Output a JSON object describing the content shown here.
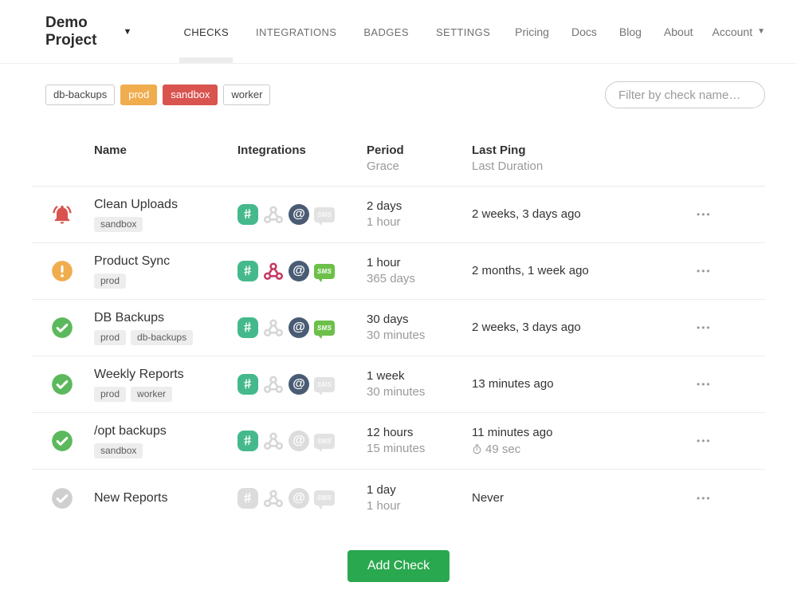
{
  "nav": {
    "project": "Demo Project",
    "tabs": [
      {
        "label": "CHECKS",
        "active": true
      },
      {
        "label": "INTEGRATIONS",
        "active": false
      },
      {
        "label": "BADGES",
        "active": false
      },
      {
        "label": "SETTINGS",
        "active": false
      }
    ],
    "links": [
      "Pricing",
      "Docs",
      "Blog",
      "About"
    ],
    "account_label": "Account"
  },
  "filters": {
    "tags": [
      {
        "label": "db-backups",
        "style": "plain"
      },
      {
        "label": "prod",
        "style": "orange"
      },
      {
        "label": "sandbox",
        "style": "red"
      },
      {
        "label": "worker",
        "style": "plain"
      }
    ],
    "search_placeholder": "Filter by check name…"
  },
  "table": {
    "headers": {
      "name": "Name",
      "integrations": "Integrations",
      "period": "Period",
      "grace": "Grace",
      "last_ping": "Last Ping",
      "last_duration": "Last Duration"
    },
    "rows": [
      {
        "status": "alert",
        "name": "Clean Uploads",
        "tags": [
          "sandbox"
        ],
        "integrations": {
          "slack": true,
          "webhook": false,
          "email": true,
          "sms": false
        },
        "period": "2 days",
        "grace": "1 hour",
        "last_ping": "2 weeks, 3 days ago",
        "last_duration": ""
      },
      {
        "status": "grace",
        "name": "Product Sync",
        "tags": [
          "prod"
        ],
        "integrations": {
          "slack": true,
          "webhook": true,
          "email": true,
          "sms": true
        },
        "period": "1 hour",
        "grace": "365 days",
        "last_ping": "2 months, 1 week ago",
        "last_duration": ""
      },
      {
        "status": "up",
        "name": "DB Backups",
        "tags": [
          "prod",
          "db-backups"
        ],
        "integrations": {
          "slack": true,
          "webhook": false,
          "email": true,
          "sms": true
        },
        "period": "30 days",
        "grace": "30 minutes",
        "last_ping": "2 weeks, 3 days ago",
        "last_duration": ""
      },
      {
        "status": "up",
        "name": "Weekly Reports",
        "tags": [
          "prod",
          "worker"
        ],
        "integrations": {
          "slack": true,
          "webhook": false,
          "email": true,
          "sms": false
        },
        "period": "1 week",
        "grace": "30 minutes",
        "last_ping": "13 minutes ago",
        "last_duration": ""
      },
      {
        "status": "up",
        "name": "/opt backups",
        "tags": [
          "sandbox"
        ],
        "integrations": {
          "slack": true,
          "webhook": false,
          "email": false,
          "sms": false
        },
        "period": "12 hours",
        "grace": "15 minutes",
        "last_ping": "11 minutes ago",
        "last_duration": "49 sec"
      },
      {
        "status": "new",
        "name": "New Reports",
        "tags": [],
        "integrations": {
          "slack": false,
          "webhook": false,
          "email": false,
          "sms": false
        },
        "period": "1 day",
        "grace": "1 hour",
        "last_ping": "Never",
        "last_duration": ""
      }
    ]
  },
  "icons": {
    "sms_label": "SMS",
    "menu_dots": "•••"
  },
  "add_check_label": "Add Check"
}
